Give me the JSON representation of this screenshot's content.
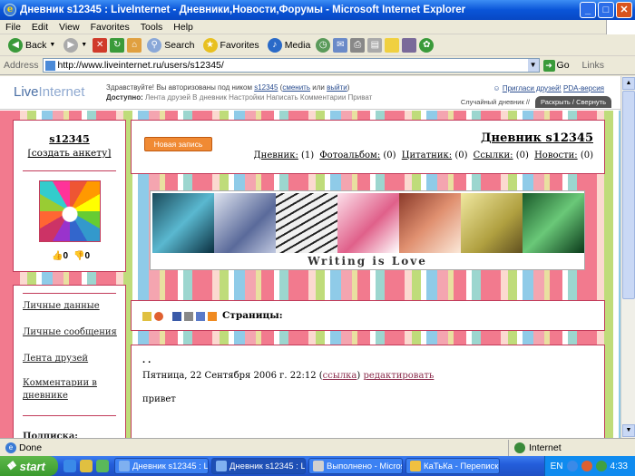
{
  "window": {
    "title": "Дневник s12345 : LiveInternet - Дневники,Новости,Форумы - Microsoft Internet Explorer"
  },
  "menu": [
    "File",
    "Edit",
    "View",
    "Favorites",
    "Tools",
    "Help"
  ],
  "toolbar": {
    "back": "Back",
    "search": "Search",
    "favorites": "Favorites",
    "media": "Media"
  },
  "address": {
    "label": "Address",
    "url": "http://www.liveinternet.ru/users/s12345/",
    "go": "Go",
    "links": "Links"
  },
  "site": {
    "logo_a": "Live",
    "logo_b": "Internet",
    "hello_prefix": "Здравствуйте! Вы авторизованы под ником",
    "hello_nick": "s12345",
    "hello_change": "сменить",
    "hello_or": "или",
    "hello_exit": "выйти",
    "access_label": "Доступно:",
    "access_items": "Лента друзей  В дневник  Настройки  Написать  Комментарии  Приват",
    "invite": "Пригласи друзей!",
    "pda": "PDA-версия",
    "tab_random": "Случайный дневник //",
    "tab_expand": "Раскрыть / Свернуть"
  },
  "profile": {
    "username": "s12345",
    "create_profile": "[создать анкету]",
    "rating_up": "0",
    "rating_down": "0"
  },
  "sidebar": {
    "links": [
      "Личные данные",
      "Личные сообщения",
      "Лента друзей",
      "Комментарии в дневнике"
    ],
    "subscription": "Подписка:"
  },
  "diary": {
    "new_post": "Новая запись",
    "title": "Дневник s12345",
    "counts": [
      {
        "label": "Дневник:",
        "value": "(1)"
      },
      {
        "label": "Фотоальбом:",
        "value": "(0)"
      },
      {
        "label": "Цитатник:",
        "value": "(0)"
      },
      {
        "label": "Ссылки:",
        "value": "(0)"
      },
      {
        "label": "Новости:",
        "value": "(0)"
      }
    ],
    "banner_text": "Writing is Love",
    "pages_label": "Страницы:"
  },
  "post": {
    "dots": ". .",
    "date": "Пятница, 22 Сентября 2006 г. 22:12",
    "link": "ссылка",
    "edit": "редактировать",
    "body": "привет"
  },
  "status": {
    "left": "Done",
    "zone": "Internet"
  },
  "taskbar": {
    "start": "start",
    "tasks": [
      "Дневник s12345 : Li...",
      "Дневник s12345 : Li...",
      "Выполнено - Microso...",
      "КаТьКа - Переписка"
    ],
    "lang": "EN",
    "clock": "4:33"
  },
  "colors": {
    "accent": "#c23b5a",
    "new_post": "#f08a34",
    "xp_blue": "#245edb"
  }
}
